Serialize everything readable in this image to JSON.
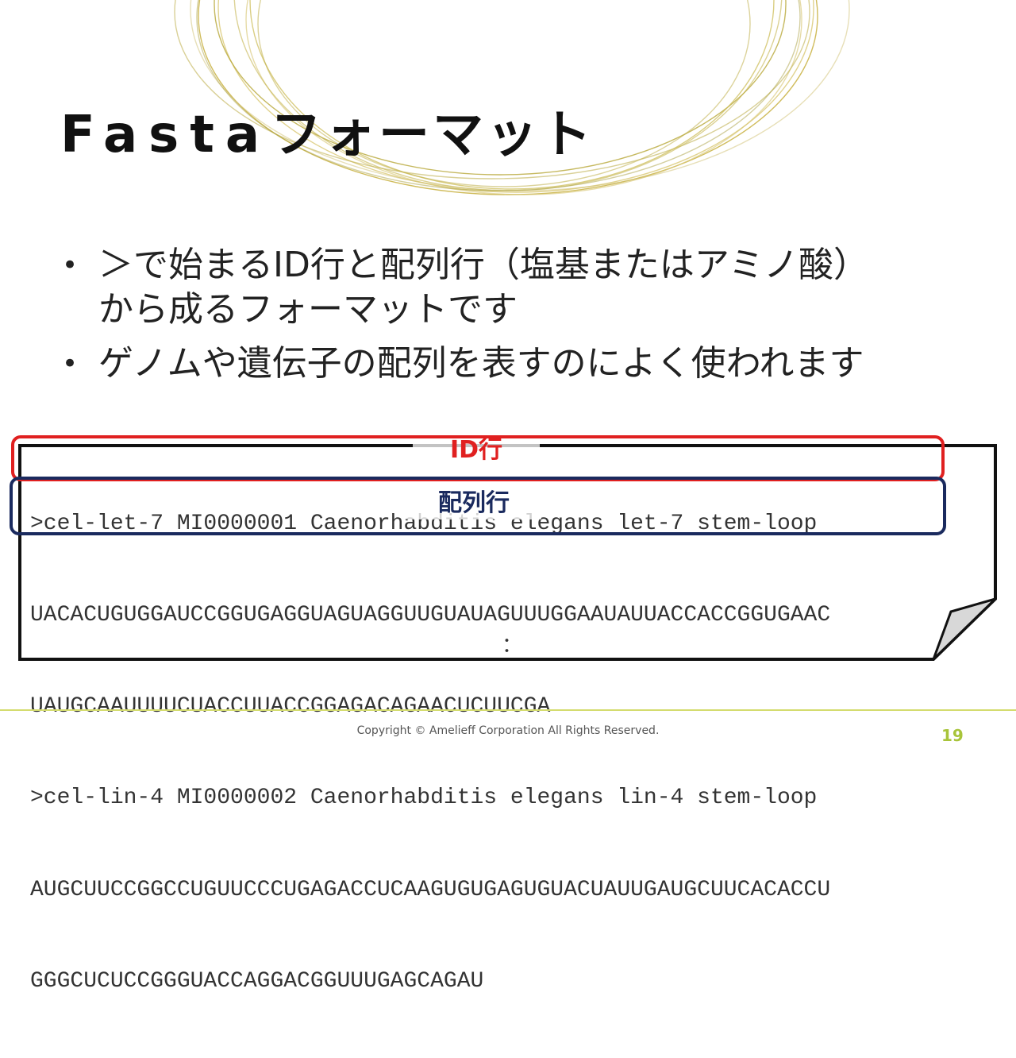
{
  "slide": {
    "title_latin": "Fasta",
    "title_kana": "フォーマット",
    "bullets": [
      {
        "line1": "＞で始まるID行と配列行（塩基またはアミノ酸）",
        "line2": "から成るフォーマットです"
      },
      {
        "line1": "ゲノムや遺伝子の配列を表すのによく使われます",
        "line2": ""
      }
    ],
    "bullet_symbol": "•"
  },
  "fasta_example": {
    "lines": [
      ">cel-let-7 MI0000001 Caenorhabditis elegans let-7 stem-loop",
      "UACACUGUGGAUCCGGUGAGGUAGUAGGUUGUAUAGUUUGGAAUAUUACCACCGGUGAAC",
      "UAUGCAAUUUUCUACCUUACCGGAGACAGAACUCUUCGA",
      ">cel-lin-4 MI0000002 Caenorhabditis elegans lin-4 stem-loop",
      "AUGCUUCCGGCCUGUUCCCUGAGACCUCAAGUGUGAGUGUACUAUUGAUGCUUCACACCU",
      "GGGCUCUCCGGGUACCAGGACGGUUUGAGCAGAU"
    ],
    "ellipsis": "："
  },
  "annotations": {
    "id_label": "ID行",
    "seq_label": "配列行"
  },
  "footer": {
    "copyright": "Copyright © Amelieff Corporation All Rights Reserved.",
    "page_number": "19"
  },
  "colors": {
    "id_box": "#e02020",
    "seq_box": "#1a2a5e",
    "accent": "#a8c43a",
    "deco_gold": "#c8b040"
  }
}
